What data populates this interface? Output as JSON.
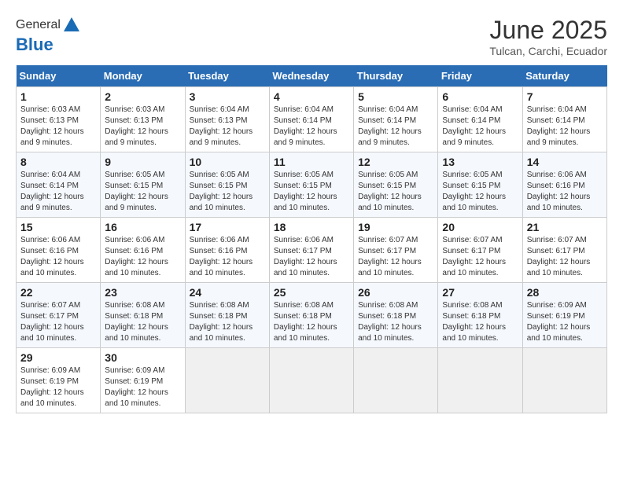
{
  "header": {
    "logo_general": "General",
    "logo_blue": "Blue",
    "month_year": "June 2025",
    "location": "Tulcan, Carchi, Ecuador"
  },
  "weekdays": [
    "Sunday",
    "Monday",
    "Tuesday",
    "Wednesday",
    "Thursday",
    "Friday",
    "Saturday"
  ],
  "weeks": [
    [
      {
        "day": "1",
        "sunrise": "6:03 AM",
        "sunset": "6:13 PM",
        "daylight": "12 hours and 9 minutes."
      },
      {
        "day": "2",
        "sunrise": "6:03 AM",
        "sunset": "6:13 PM",
        "daylight": "12 hours and 9 minutes."
      },
      {
        "day": "3",
        "sunrise": "6:04 AM",
        "sunset": "6:13 PM",
        "daylight": "12 hours and 9 minutes."
      },
      {
        "day": "4",
        "sunrise": "6:04 AM",
        "sunset": "6:14 PM",
        "daylight": "12 hours and 9 minutes."
      },
      {
        "day": "5",
        "sunrise": "6:04 AM",
        "sunset": "6:14 PM",
        "daylight": "12 hours and 9 minutes."
      },
      {
        "day": "6",
        "sunrise": "6:04 AM",
        "sunset": "6:14 PM",
        "daylight": "12 hours and 9 minutes."
      },
      {
        "day": "7",
        "sunrise": "6:04 AM",
        "sunset": "6:14 PM",
        "daylight": "12 hours and 9 minutes."
      }
    ],
    [
      {
        "day": "8",
        "sunrise": "6:04 AM",
        "sunset": "6:14 PM",
        "daylight": "12 hours and 9 minutes."
      },
      {
        "day": "9",
        "sunrise": "6:05 AM",
        "sunset": "6:15 PM",
        "daylight": "12 hours and 9 minutes."
      },
      {
        "day": "10",
        "sunrise": "6:05 AM",
        "sunset": "6:15 PM",
        "daylight": "12 hours and 10 minutes."
      },
      {
        "day": "11",
        "sunrise": "6:05 AM",
        "sunset": "6:15 PM",
        "daylight": "12 hours and 10 minutes."
      },
      {
        "day": "12",
        "sunrise": "6:05 AM",
        "sunset": "6:15 PM",
        "daylight": "12 hours and 10 minutes."
      },
      {
        "day": "13",
        "sunrise": "6:05 AM",
        "sunset": "6:15 PM",
        "daylight": "12 hours and 10 minutes."
      },
      {
        "day": "14",
        "sunrise": "6:06 AM",
        "sunset": "6:16 PM",
        "daylight": "12 hours and 10 minutes."
      }
    ],
    [
      {
        "day": "15",
        "sunrise": "6:06 AM",
        "sunset": "6:16 PM",
        "daylight": "12 hours and 10 minutes."
      },
      {
        "day": "16",
        "sunrise": "6:06 AM",
        "sunset": "6:16 PM",
        "daylight": "12 hours and 10 minutes."
      },
      {
        "day": "17",
        "sunrise": "6:06 AM",
        "sunset": "6:16 PM",
        "daylight": "12 hours and 10 minutes."
      },
      {
        "day": "18",
        "sunrise": "6:06 AM",
        "sunset": "6:17 PM",
        "daylight": "12 hours and 10 minutes."
      },
      {
        "day": "19",
        "sunrise": "6:07 AM",
        "sunset": "6:17 PM",
        "daylight": "12 hours and 10 minutes."
      },
      {
        "day": "20",
        "sunrise": "6:07 AM",
        "sunset": "6:17 PM",
        "daylight": "12 hours and 10 minutes."
      },
      {
        "day": "21",
        "sunrise": "6:07 AM",
        "sunset": "6:17 PM",
        "daylight": "12 hours and 10 minutes."
      }
    ],
    [
      {
        "day": "22",
        "sunrise": "6:07 AM",
        "sunset": "6:17 PM",
        "daylight": "12 hours and 10 minutes."
      },
      {
        "day": "23",
        "sunrise": "6:08 AM",
        "sunset": "6:18 PM",
        "daylight": "12 hours and 10 minutes."
      },
      {
        "day": "24",
        "sunrise": "6:08 AM",
        "sunset": "6:18 PM",
        "daylight": "12 hours and 10 minutes."
      },
      {
        "day": "25",
        "sunrise": "6:08 AM",
        "sunset": "6:18 PM",
        "daylight": "12 hours and 10 minutes."
      },
      {
        "day": "26",
        "sunrise": "6:08 AM",
        "sunset": "6:18 PM",
        "daylight": "12 hours and 10 minutes."
      },
      {
        "day": "27",
        "sunrise": "6:08 AM",
        "sunset": "6:18 PM",
        "daylight": "12 hours and 10 minutes."
      },
      {
        "day": "28",
        "sunrise": "6:09 AM",
        "sunset": "6:19 PM",
        "daylight": "12 hours and 10 minutes."
      }
    ],
    [
      {
        "day": "29",
        "sunrise": "6:09 AM",
        "sunset": "6:19 PM",
        "daylight": "12 hours and 10 minutes."
      },
      {
        "day": "30",
        "sunrise": "6:09 AM",
        "sunset": "6:19 PM",
        "daylight": "12 hours and 10 minutes."
      },
      null,
      null,
      null,
      null,
      null
    ]
  ]
}
